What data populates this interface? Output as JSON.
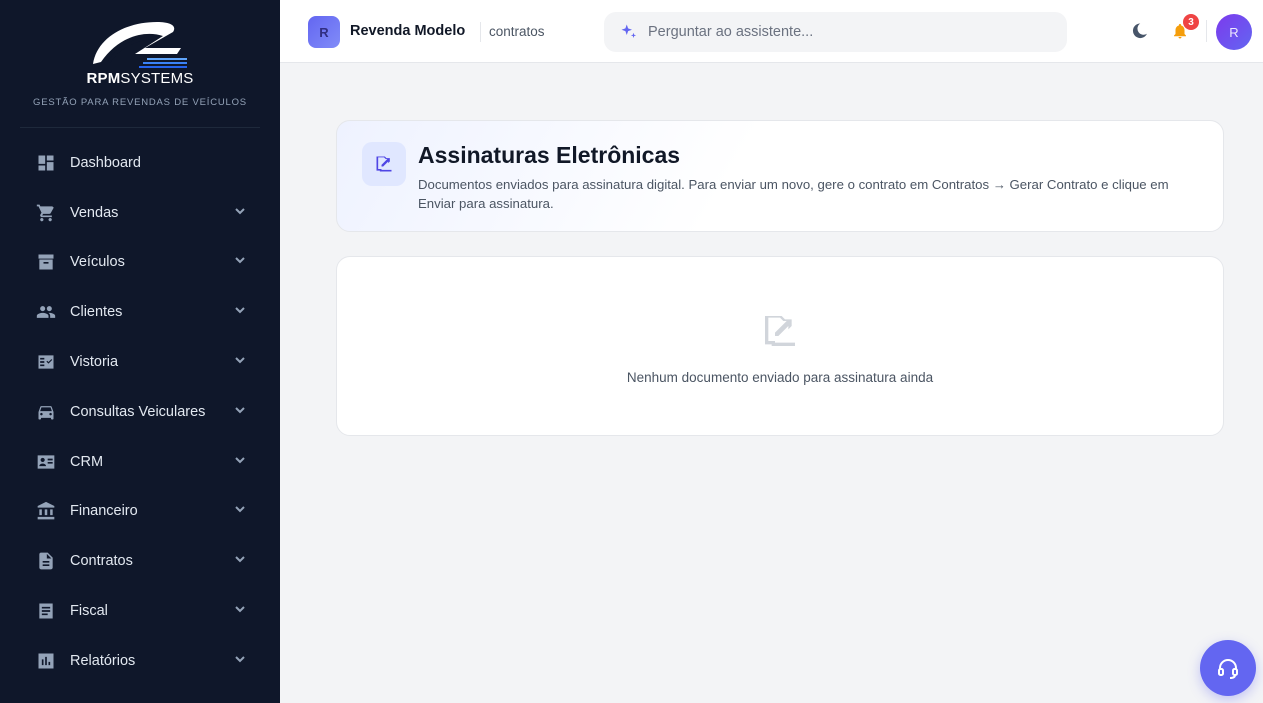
{
  "brand": {
    "logo_bold": "RPM",
    "logo_rest": "SYSTEMS",
    "tagline": "GESTÃO PARA REVENDAS DE VEÍCULOS"
  },
  "sidebar": {
    "items": [
      {
        "label": "Dashboard",
        "icon": "dashboard-icon",
        "expandable": false
      },
      {
        "label": "Vendas",
        "icon": "cart-icon",
        "expandable": true
      },
      {
        "label": "Veículos",
        "icon": "archive-icon",
        "expandable": true
      },
      {
        "label": "Clientes",
        "icon": "people-icon",
        "expandable": true
      },
      {
        "label": "Vistoria",
        "icon": "checklist-icon",
        "expandable": true
      },
      {
        "label": "Consultas Veiculares",
        "icon": "car-icon",
        "expandable": true
      },
      {
        "label": "CRM",
        "icon": "contact-card-icon",
        "expandable": true
      },
      {
        "label": "Financeiro",
        "icon": "bank-icon",
        "expandable": true
      },
      {
        "label": "Contratos",
        "icon": "document-icon",
        "expandable": true
      },
      {
        "label": "Fiscal",
        "icon": "receipt-icon",
        "expandable": true
      },
      {
        "label": "Relatórios",
        "icon": "bar-chart-icon",
        "expandable": true
      }
    ]
  },
  "header": {
    "org_initial": "R",
    "org_name": "Revenda Modelo",
    "breadcrumb": "contratos",
    "search_placeholder": "Perguntar ao assistente...",
    "notification_count": "3",
    "user_initial": "R"
  },
  "page": {
    "title": "Assinaturas Eletrônicas",
    "description": "Documentos enviados para assinatura digital. Para enviar um novo, gere o contrato em Contratos → Gerar Contrato e clique em Enviar para assinatura.",
    "empty_message": "Nenhum documento enviado para assinatura ainda"
  },
  "colors": {
    "sidebar_bg": "#0f172a",
    "accent": "#6366f1",
    "notification": "#ef4444",
    "bell": "#f59e0b"
  }
}
